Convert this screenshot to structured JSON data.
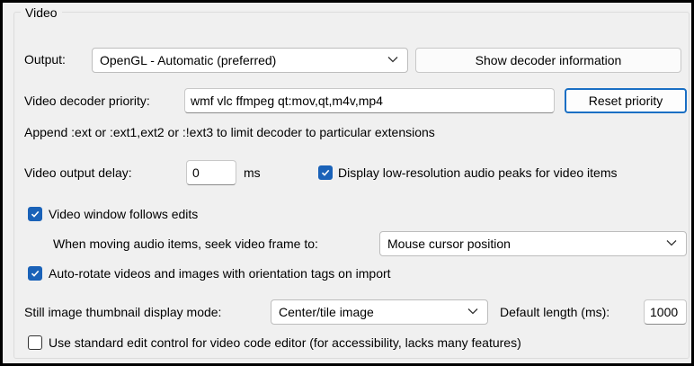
{
  "group": {
    "title": "Video"
  },
  "output": {
    "label": "Output:",
    "selected": "OpenGL - Automatic (preferred)",
    "show_decoder_button": "Show decoder information"
  },
  "decoder_priority": {
    "label": "Video decoder priority:",
    "value": "wmf vlc ffmpeg qt:mov,qt,m4v,mp4",
    "reset_button": "Reset priority",
    "hint": "Append :ext or :ext1,ext2 or :!ext3 to limit decoder to particular extensions"
  },
  "output_delay": {
    "label": "Video output delay:",
    "value": "0",
    "unit": "ms"
  },
  "low_res_peaks": {
    "label": "Display low-resolution audio peaks for video items",
    "checked": true
  },
  "window_follows_edits": {
    "label": "Video window follows edits",
    "checked": true
  },
  "seek_frame": {
    "label": "When moving audio items, seek video frame to:",
    "selected": "Mouse cursor position"
  },
  "auto_rotate": {
    "label": "Auto-rotate videos and images with orientation tags on import",
    "checked": true
  },
  "thumbnail_mode": {
    "label": "Still image thumbnail display mode:",
    "selected": "Center/tile image",
    "default_length_label": "Default length (ms):",
    "default_length_value": "1000"
  },
  "standard_edit_control": {
    "label": "Use standard edit control for video code editor (for accessibility, lacks many features)",
    "checked": false
  },
  "colors": {
    "accent": "#1a62b8",
    "panel_bg": "#f0f0f0",
    "frame_border": "#000000"
  }
}
